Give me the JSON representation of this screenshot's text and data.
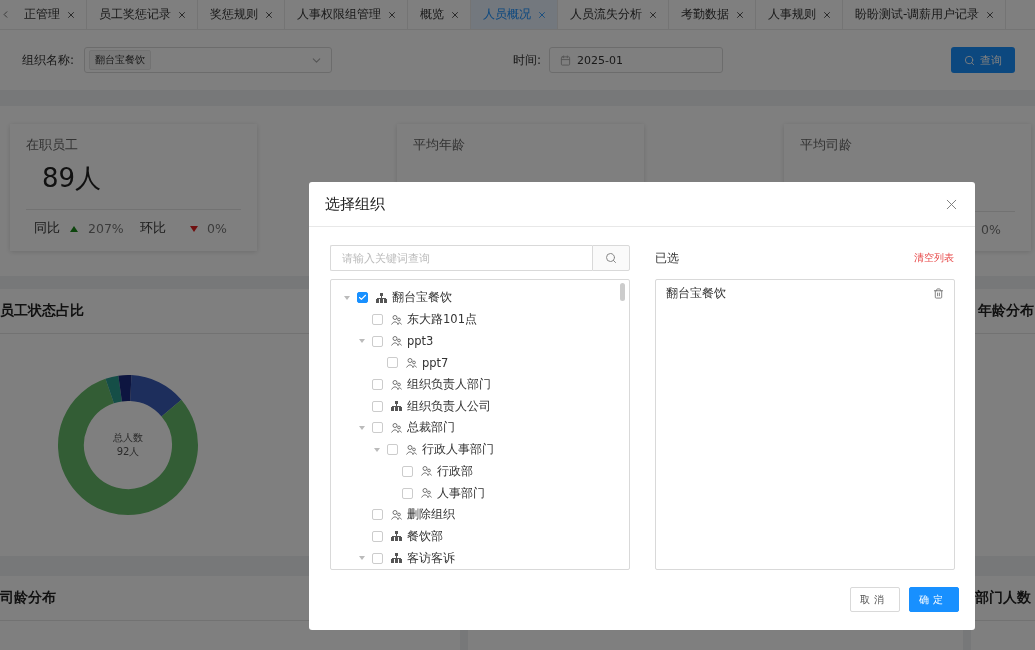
{
  "tabs": [
    {
      "label": "正管理",
      "selected": false
    },
    {
      "label": "员工奖惩记录",
      "selected": false
    },
    {
      "label": "奖惩规则",
      "selected": false
    },
    {
      "label": "人事权限组管理",
      "selected": false
    },
    {
      "label": "概览",
      "selected": false
    },
    {
      "label": "人员概况",
      "selected": true
    },
    {
      "label": "人员流失分析",
      "selected": false
    },
    {
      "label": "考勤数据",
      "selected": false
    },
    {
      "label": "人事规则",
      "selected": false
    },
    {
      "label": "盼盼测试-调薪用户记录",
      "selected": false
    }
  ],
  "filter": {
    "org_label": "组织名称:",
    "org_tag": "翻台宝餐饮",
    "time_label": "时间:",
    "time_value": "2025-01",
    "query_button": "查询"
  },
  "stats": [
    {
      "title": "在职员工",
      "value": "89人",
      "yoy": {
        "label": "同比",
        "rising": true,
        "value": "207%"
      },
      "mom": {
        "label": "环比",
        "rising": false,
        "value": "0%"
      }
    },
    {
      "title": "平均年龄"
    },
    {
      "title": "平均司龄",
      "mom": {
        "value": "0%"
      }
    }
  ],
  "panels": [
    {
      "title": "员工状态占比",
      "chart": {
        "kind": "picture",
        "center_label": "总人数",
        "center_value": "92人"
      }
    },
    {
      "title": "年龄分布"
    }
  ],
  "bottom_panels": [
    {
      "title": "司龄分布"
    },
    {
      "title": "部门人数"
    }
  ],
  "dialog": {
    "title": "选择组织",
    "search_placeholder": "请输入关键词查询",
    "tree": [
      {
        "label": "翻台宝餐饮",
        "kind": "company",
        "checked": true,
        "expanded": true,
        "children": [
          {
            "label": "东大路101点",
            "kind": "department",
            "checked": false
          },
          {
            "label": "ppt3",
            "kind": "department",
            "checked": false,
            "expanded": true,
            "children": [
              {
                "label": "ppt7",
                "kind": "department",
                "checked": false
              }
            ]
          },
          {
            "label": "组织负责人部门",
            "kind": "department",
            "checked": false
          },
          {
            "label": "组织负责人公司",
            "kind": "company",
            "checked": false
          },
          {
            "label": "总裁部门",
            "kind": "department",
            "checked": false,
            "expanded": true,
            "children": [
              {
                "label": "行政人事部门",
                "kind": "department",
                "checked": false,
                "expanded": true,
                "children": [
                  {
                    "label": "行政部",
                    "kind": "department",
                    "checked": false
                  },
                  {
                    "label": "人事部门",
                    "kind": "department",
                    "checked": false
                  }
                ]
              }
            ]
          },
          {
            "label": "删除组织",
            "kind": "department",
            "checked": false
          },
          {
            "label": "餐饮部",
            "kind": "company",
            "checked": false
          },
          {
            "label": "客访客诉",
            "kind": "company",
            "checked": false,
            "expanded": true
          }
        ]
      }
    ],
    "selected_label": "已选",
    "clear_link": "清空列表",
    "selected_items": [
      "翻台宝餐饮"
    ],
    "cancel_button": "取消",
    "ok_button": "确定"
  }
}
